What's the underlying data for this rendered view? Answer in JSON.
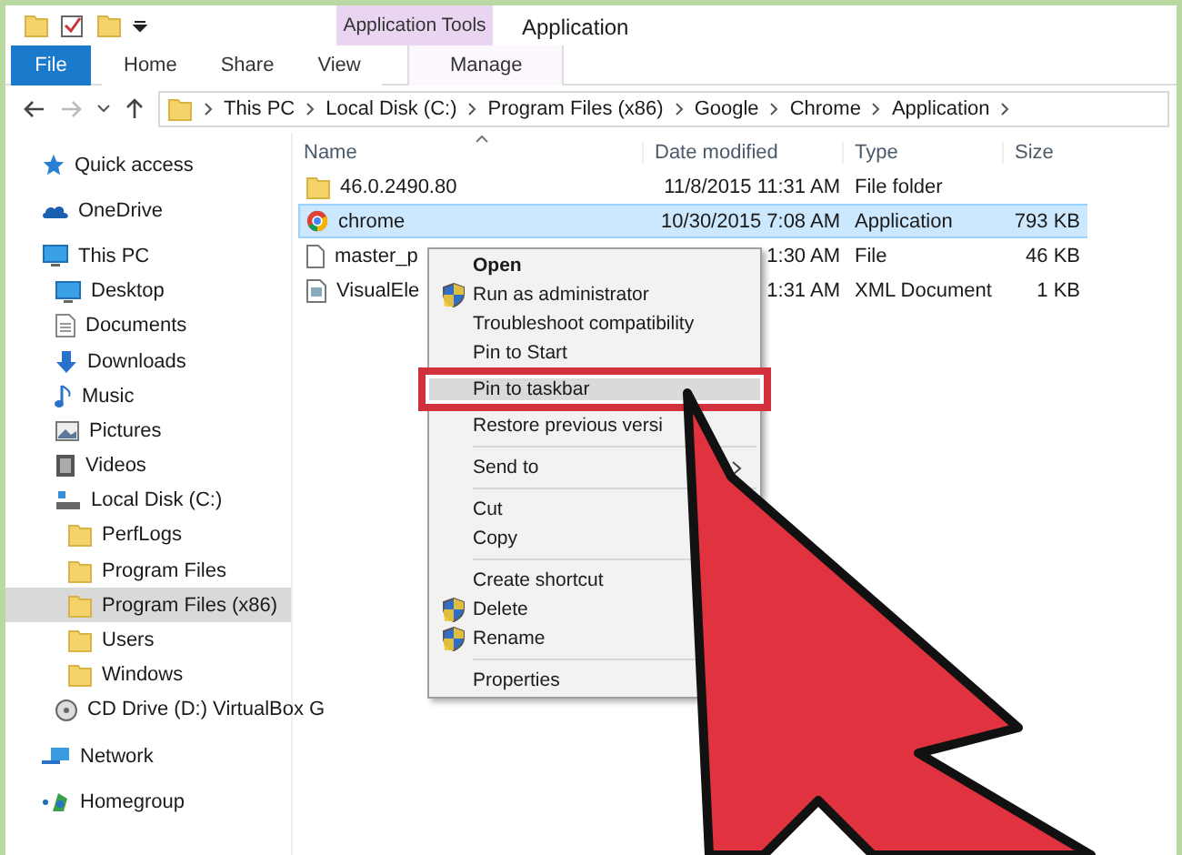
{
  "ribbon": {
    "context_group": "Application Tools",
    "title": "Application",
    "tabs": [
      {
        "label": "File",
        "kind": "file"
      },
      {
        "label": "Home",
        "kind": "tab"
      },
      {
        "label": "Share",
        "kind": "tab"
      },
      {
        "label": "View",
        "kind": "tab"
      },
      {
        "label": "Manage",
        "kind": "context"
      }
    ]
  },
  "address": {
    "crumbs": [
      "This PC",
      "Local Disk (C:)",
      "Program Files (x86)",
      "Google",
      "Chrome",
      "Application"
    ]
  },
  "sidebar": {
    "items": [
      {
        "label": "Quick access",
        "kind": "star",
        "selected": false
      },
      {
        "label": "OneDrive",
        "kind": "cloud",
        "selected": false
      },
      {
        "label": "This PC",
        "kind": "pc",
        "selected": false,
        "children": [
          {
            "label": "Desktop",
            "kind": "desktop",
            "selected": false
          },
          {
            "label": "Documents",
            "kind": "docs",
            "selected": false
          },
          {
            "label": "Downloads",
            "kind": "download",
            "selected": false
          },
          {
            "label": "Music",
            "kind": "music",
            "selected": false
          },
          {
            "label": "Pictures",
            "kind": "pictures",
            "selected": false
          },
          {
            "label": "Videos",
            "kind": "videos",
            "selected": false
          },
          {
            "label": "Local Disk (C:)",
            "kind": "disk",
            "selected": false,
            "children": [
              {
                "label": "PerfLogs",
                "kind": "folder",
                "selected": false
              },
              {
                "label": "Program Files",
                "kind": "folder",
                "selected": false
              },
              {
                "label": "Program Files (x86)",
                "kind": "folder",
                "selected": true
              },
              {
                "label": "Users",
                "kind": "folder",
                "selected": false
              },
              {
                "label": "Windows",
                "kind": "folder",
                "selected": false
              }
            ]
          },
          {
            "label": "CD Drive (D:) VirtualBox G",
            "kind": "cd",
            "selected": false
          }
        ]
      },
      {
        "label": "Network",
        "kind": "network",
        "selected": false
      },
      {
        "label": "Homegroup",
        "kind": "homegroup",
        "selected": false
      }
    ]
  },
  "table": {
    "columns": [
      "Name",
      "Date modified",
      "Type",
      "Size"
    ],
    "rows": [
      {
        "name": "46.0.2490.80",
        "date": "11/8/2015 11:31 AM",
        "type": "File folder",
        "size": "",
        "kind": "folder",
        "selected": false
      },
      {
        "name": "chrome",
        "date": "10/30/2015 7:08 AM",
        "type": "Application",
        "size": "793 KB",
        "kind": "chrome",
        "selected": true
      },
      {
        "name": "master_p",
        "date": "1:30 AM",
        "type": "File",
        "size": "46 KB",
        "kind": "file",
        "selected": false
      },
      {
        "name": "VisualEle",
        "date": "1:31 AM",
        "type": "XML Document",
        "size": "1 KB",
        "kind": "xml",
        "selected": false
      }
    ]
  },
  "context_menu": {
    "items": [
      {
        "kind": "item",
        "label": "Open",
        "shield": false,
        "submenu": false,
        "highlighted": false,
        "bold": true
      },
      {
        "kind": "item",
        "label": "Run as administrator",
        "shield": true,
        "submenu": false,
        "highlighted": false,
        "bold": false
      },
      {
        "kind": "item",
        "label": "Troubleshoot compatibility",
        "shield": false,
        "submenu": false,
        "highlighted": false,
        "bold": false
      },
      {
        "kind": "item",
        "label": "Pin to Start",
        "shield": false,
        "submenu": false,
        "highlighted": false,
        "bold": false
      },
      {
        "kind": "item",
        "label": "Pin to taskbar",
        "shield": false,
        "submenu": false,
        "highlighted": true,
        "bold": false
      },
      {
        "kind": "item",
        "label": "Restore previous versi",
        "shield": false,
        "submenu": false,
        "highlighted": false,
        "bold": false
      },
      {
        "kind": "separator"
      },
      {
        "kind": "item",
        "label": "Send to",
        "shield": false,
        "submenu": true,
        "highlighted": false,
        "bold": false
      },
      {
        "kind": "separator"
      },
      {
        "kind": "item",
        "label": "Cut",
        "shield": false,
        "submenu": false,
        "highlighted": false,
        "bold": false
      },
      {
        "kind": "item",
        "label": "Copy",
        "shield": false,
        "submenu": false,
        "highlighted": false,
        "bold": false
      },
      {
        "kind": "separator"
      },
      {
        "kind": "item",
        "label": "Create shortcut",
        "shield": false,
        "submenu": false,
        "highlighted": false,
        "bold": false
      },
      {
        "kind": "item",
        "label": "Delete",
        "shield": true,
        "submenu": false,
        "highlighted": false,
        "bold": false
      },
      {
        "kind": "item",
        "label": "Rename",
        "shield": true,
        "submenu": false,
        "highlighted": false,
        "bold": false
      },
      {
        "kind": "separator"
      },
      {
        "kind": "item",
        "label": "Properties",
        "shield": false,
        "submenu": false,
        "highlighted": false,
        "bold": false
      }
    ]
  }
}
